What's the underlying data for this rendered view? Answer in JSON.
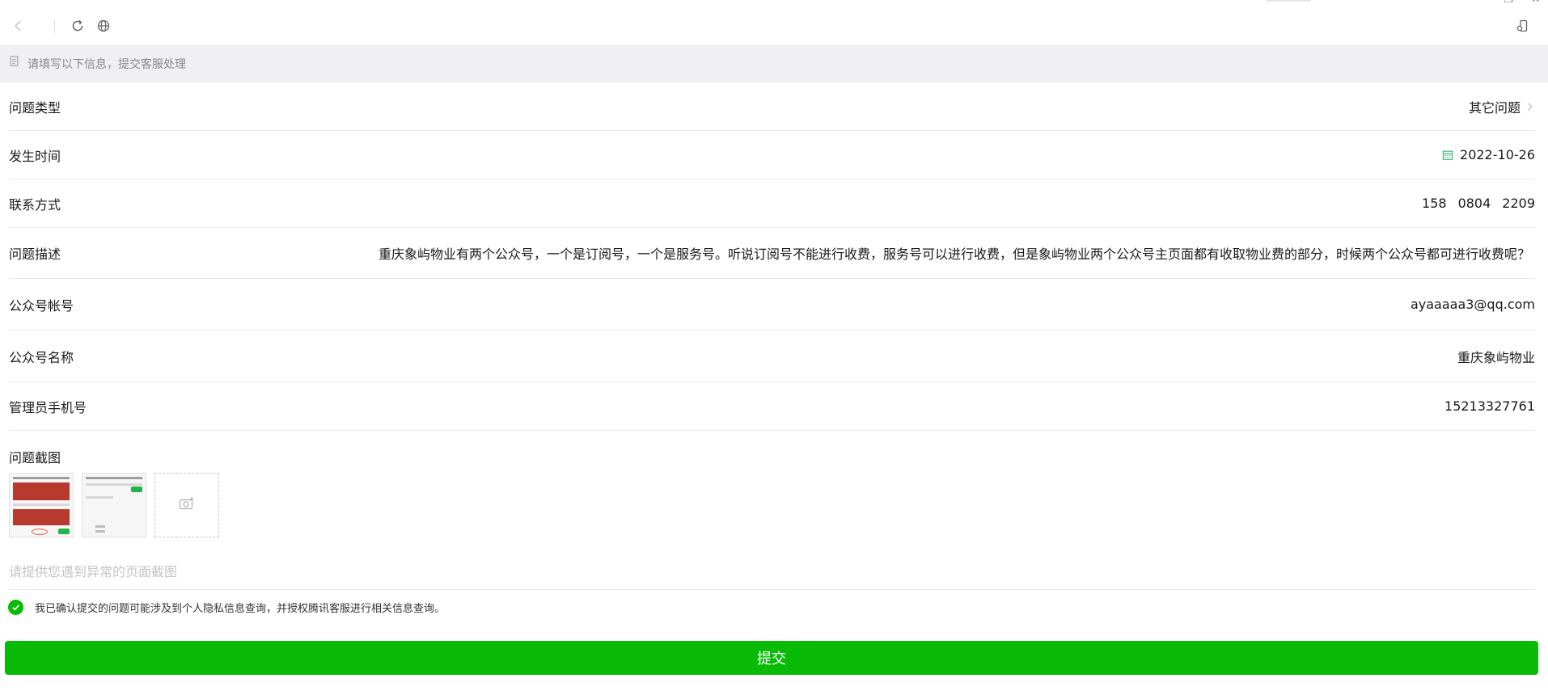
{
  "toolbar": {
    "icons": [
      "back-arrow-icon",
      "reload-icon",
      "globe-icon",
      "page-action-icon"
    ]
  },
  "notice": {
    "icon": "document-icon",
    "text": "请填写以下信息，提交客服处理"
  },
  "form": {
    "issue_type": {
      "label": "问题类型",
      "value": "其它问题"
    },
    "occurred_time": {
      "label": "发生时间",
      "value": "2022-10-26"
    },
    "contact": {
      "label": "联系方式",
      "parts": [
        "158",
        "0804",
        "2209"
      ]
    },
    "description": {
      "label": "问题描述",
      "value": "重庆象屿物业有两个公众号，一个是订阅号，一个是服务号。听说订阅号不能进行收费，服务号可以进行收费，但是象屿物业两个公众号主页面都有收取物业费的部分，时候两个公众号都可进行收费呢？"
    },
    "account": {
      "label": "公众号帐号",
      "value": "ayaaaaa3@qq.com"
    },
    "account_name": {
      "label": "公众号名称",
      "value": "重庆象屿物业"
    },
    "admin_phone": {
      "label": "管理员手机号",
      "value": "15213327761"
    }
  },
  "screenshots": {
    "label": "问题截图",
    "placeholder": "请提供您遇到异常的页面截图",
    "count": 2
  },
  "consent": {
    "checked": true,
    "text": "我已确认提交的问题可能涉及到个人隐私信息查询，并授权腾讯客服进行相关信息查询。"
  },
  "submit": {
    "label": "提交"
  },
  "colors": {
    "accent": "#09bb07",
    "notice_bg": "#efeff4",
    "calendar_icon": "#2aae67",
    "placeholder": "#c4c4c4"
  }
}
